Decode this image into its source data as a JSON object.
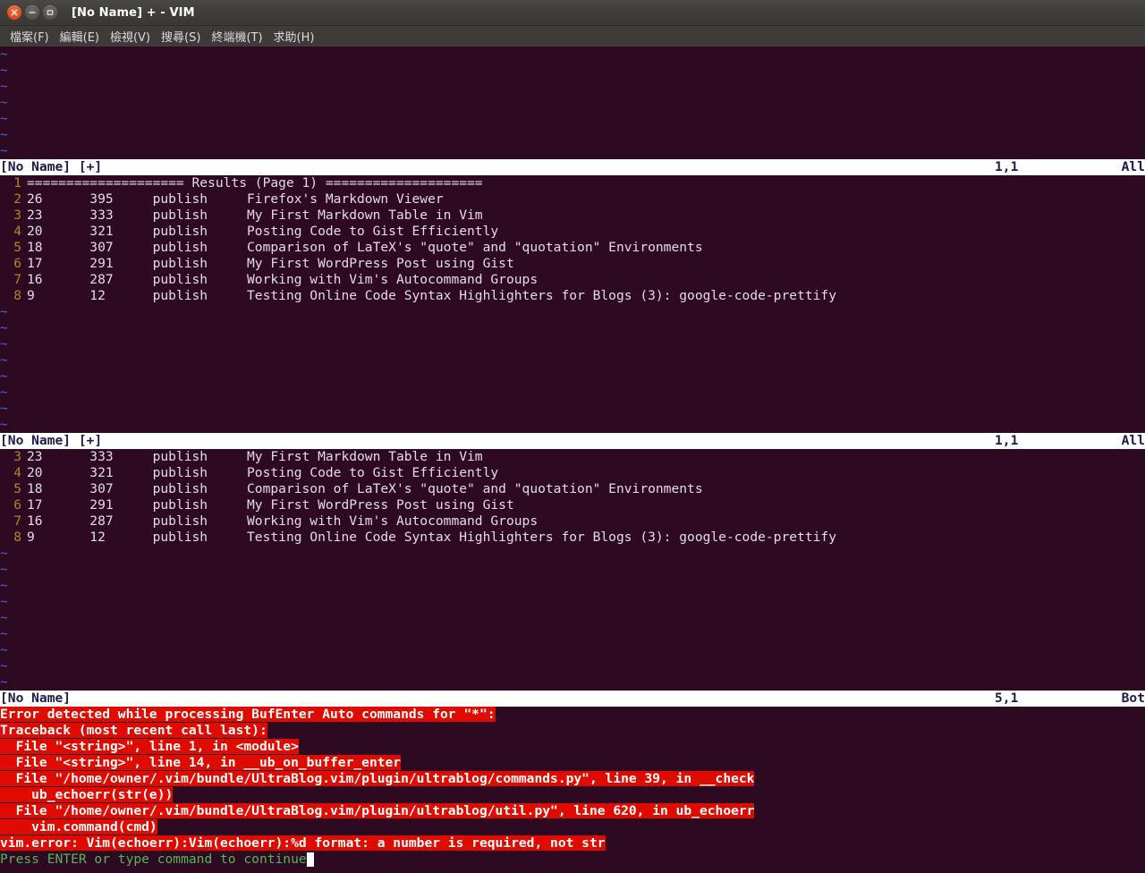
{
  "window": {
    "title": "[No Name] + - VIM",
    "controls": [
      {
        "name": "close",
        "glyph": "x"
      },
      {
        "name": "minimize",
        "glyph": "-"
      },
      {
        "name": "maximize",
        "glyph": "square"
      }
    ]
  },
  "menu": {
    "items": [
      {
        "label": "檔案(F)"
      },
      {
        "label": "編輯(E)"
      },
      {
        "label": "檢視(V)"
      },
      {
        "label": "搜尋(S)"
      },
      {
        "label": "終端機(T)"
      },
      {
        "label": "求助(H)"
      }
    ]
  },
  "colors": {
    "background": "#2d0922",
    "foreground": "#ded6e0",
    "linenumber": "#a68b1e",
    "tilde": "#5a5ad2",
    "status_bg": "#ffffff",
    "status_fg": "#1d1a4e",
    "error_bg": "#e00b00",
    "error_fg": "#ffffff",
    "prompt_fg": "#56b556",
    "titlebar_bg": "#3c3b37",
    "close_button": "#dd4814"
  },
  "windows": [
    {
      "id": "window-top",
      "empty_lines": 7,
      "statusline": {
        "name": "[No Name] [+]",
        "position": "1,1",
        "scroll": "All"
      }
    },
    {
      "id": "window-middle",
      "lines": [
        {
          "num": "1",
          "text": "==================== Results (Page 1) ===================="
        },
        {
          "num": "2",
          "text": "26      395     publish     Firefox's Markdown Viewer"
        },
        {
          "num": "3",
          "text": "23      333     publish     My First Markdown Table in Vim"
        },
        {
          "num": "4",
          "text": "20      321     publish     Posting Code to Gist Efficiently"
        },
        {
          "num": "5",
          "text": "18      307     publish     Comparison of LaTeX's \"quote\" and \"quotation\" Environments"
        },
        {
          "num": "6",
          "text": "17      291     publish     My First WordPress Post using Gist"
        },
        {
          "num": "7",
          "text": "16      287     publish     Working with Vim's Autocommand Groups"
        },
        {
          "num": "8",
          "text": "9       12      publish     Testing Online Code Syntax Highlighters for Blogs (3): google-code-prettify"
        }
      ],
      "empty_lines": 8,
      "statusline": {
        "name": "[No Name] [+]",
        "position": "1,1",
        "scroll": "All"
      }
    },
    {
      "id": "window-bottom",
      "lines": [
        {
          "num": "3",
          "text": "23      333     publish     My First Markdown Table in Vim"
        },
        {
          "num": "4",
          "text": "20      321     publish     Posting Code to Gist Efficiently"
        },
        {
          "num": "5",
          "text": "18      307     publish     Comparison of LaTeX's \"quote\" and \"quotation\" Environments"
        },
        {
          "num": "6",
          "text": "17      291     publish     My First WordPress Post using Gist"
        },
        {
          "num": "7",
          "text": "16      287     publish     Working with Vim's Autocommand Groups"
        },
        {
          "num": "8",
          "text": "9       12      publish     Testing Online Code Syntax Highlighters for Blogs (3): google-code-prettify"
        }
      ],
      "empty_lines": 9,
      "statusline": {
        "name": "[No Name]",
        "position": "5,1",
        "scroll": "Bot"
      }
    }
  ],
  "message_area": {
    "error_lines": [
      "Error detected while processing BufEnter Auto commands for \"*\":",
      "Traceback (most recent call last):",
      "  File \"<string>\", line 1, in <module>",
      "  File \"<string>\", line 14, in __ub_on_buffer_enter",
      "  File \"/home/owner/.vim/bundle/UltraBlog.vim/plugin/ultrablog/commands.py\", line 39, in __check",
      "    ub_echoerr(str(e))",
      "  File \"/home/owner/.vim/bundle/UltraBlog.vim/plugin/ultrablog/util.py\", line 620, in ub_echoerr",
      "    vim.command(cmd)",
      "vim.error: Vim(echoerr):Vim(echoerr):%d format: a number is required, not str"
    ],
    "prompt": "Press ENTER or type command to continue"
  }
}
